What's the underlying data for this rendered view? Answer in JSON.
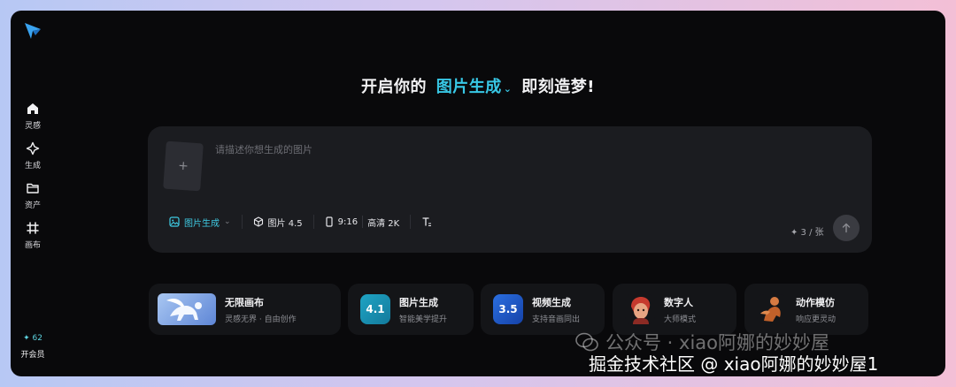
{
  "sidebar": {
    "items": [
      {
        "label": "灵感",
        "icon": "home-icon"
      },
      {
        "label": "生成",
        "icon": "sparkle-icon"
      },
      {
        "label": "资产",
        "icon": "folder-icon"
      },
      {
        "label": "画布",
        "icon": "canvas-icon"
      }
    ],
    "credits": "✦ 62",
    "vip_label": "开会员"
  },
  "headline": {
    "prefix": "开启你的",
    "mode": "图片生成",
    "suffix": "即刻造梦!"
  },
  "prompt": {
    "placeholder": "请描述你想生成的图片",
    "upload_icon": "+"
  },
  "toolbar": {
    "mode_label": "图片生成",
    "model_label": "图片 4.5",
    "ratio_label": "9:16",
    "quality_label": "高清 2K",
    "text_icon": "text-style-icon"
  },
  "cost": "✦ 3 / 张",
  "cards": [
    {
      "title": "无限画布",
      "subtitle": "灵感无界 · 自由创作"
    },
    {
      "title": "图片生成",
      "subtitle": "智能美学提升",
      "badge": "4.1"
    },
    {
      "title": "视频生成",
      "subtitle": "支持音画同出",
      "badge": "3.5"
    },
    {
      "title": "数字人",
      "subtitle": "大师模式"
    },
    {
      "title": "动作模仿",
      "subtitle": "响应更灵动"
    }
  ],
  "watermark": {
    "line1": "公众号 · xiao阿娜的妙妙屋",
    "line2": "掘金技术社区 @ xiao阿娜的妙妙屋1"
  },
  "colors": {
    "accent": "#38c8e6",
    "background": "#09090b",
    "panel": "#1b1c20"
  }
}
